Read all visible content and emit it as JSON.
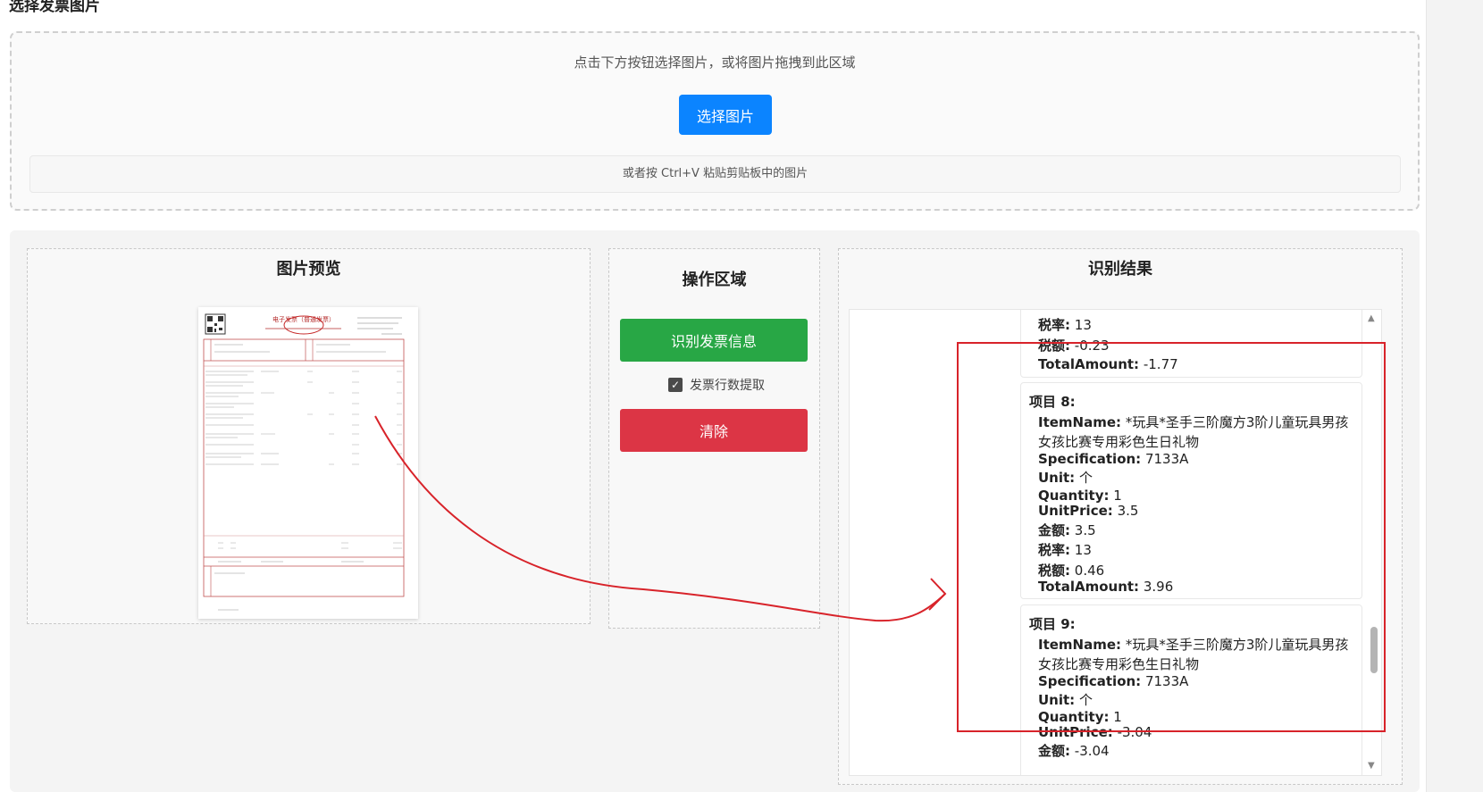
{
  "page": {
    "section_title": "选择发票图片"
  },
  "upload": {
    "hint": "点击下方按钮选择图片，或将图片拖拽到此区域",
    "choose_button": "选择图片",
    "paste_hint": "或者按 Ctrl+V 粘贴剪贴板中的图片"
  },
  "preview": {
    "title": "图片预览",
    "invoice_heading": "电子发票（普通发票）"
  },
  "operations": {
    "title": "操作区域",
    "recognize_button": "识别发票信息",
    "row_extract_label": "发票行数提取",
    "row_extract_checked": true,
    "clear_button": "清除"
  },
  "results": {
    "title": "识别结果",
    "partial_top": {
      "tax_rate_label": "税率:",
      "tax_rate": "13",
      "tax_amount_label": "税额:",
      "tax_amount": "-0.23",
      "total_label": "TotalAmount:",
      "total": "-1.77"
    },
    "items": [
      {
        "title": "项目 8:",
        "item_name_label": "ItemName:",
        "item_name": "*玩具*圣手三阶魔方3阶儿童玩具男孩女孩比赛专用彩色生日礼物",
        "spec_label": "Specification:",
        "spec": "7133A",
        "unit_label": "Unit:",
        "unit": "个",
        "qty_label": "Quantity:",
        "qty": "1",
        "price_label": "UnitPrice:",
        "price": "3.5",
        "amount_label": "金额:",
        "amount": "3.5",
        "tax_rate_label": "税率:",
        "tax_rate": "13",
        "tax_amount_label": "税额:",
        "tax_amount": "0.46",
        "total_label": "TotalAmount:",
        "total": "3.96"
      },
      {
        "title": "项目 9:",
        "item_name_label": "ItemName:",
        "item_name": "*玩具*圣手三阶魔方3阶儿童玩具男孩女孩比赛专用彩色生日礼物",
        "spec_label": "Specification:",
        "spec": "7133A",
        "unit_label": "Unit:",
        "unit": "个",
        "qty_label": "Quantity:",
        "qty": "1",
        "price_label": "UnitPrice:",
        "price": "-3.04",
        "amount_label": "金额:",
        "amount": "-3.04"
      }
    ]
  },
  "colors": {
    "primary": "#0b84ff",
    "success": "#28a745",
    "danger": "#dc3545",
    "annotation": "#d8232a"
  }
}
